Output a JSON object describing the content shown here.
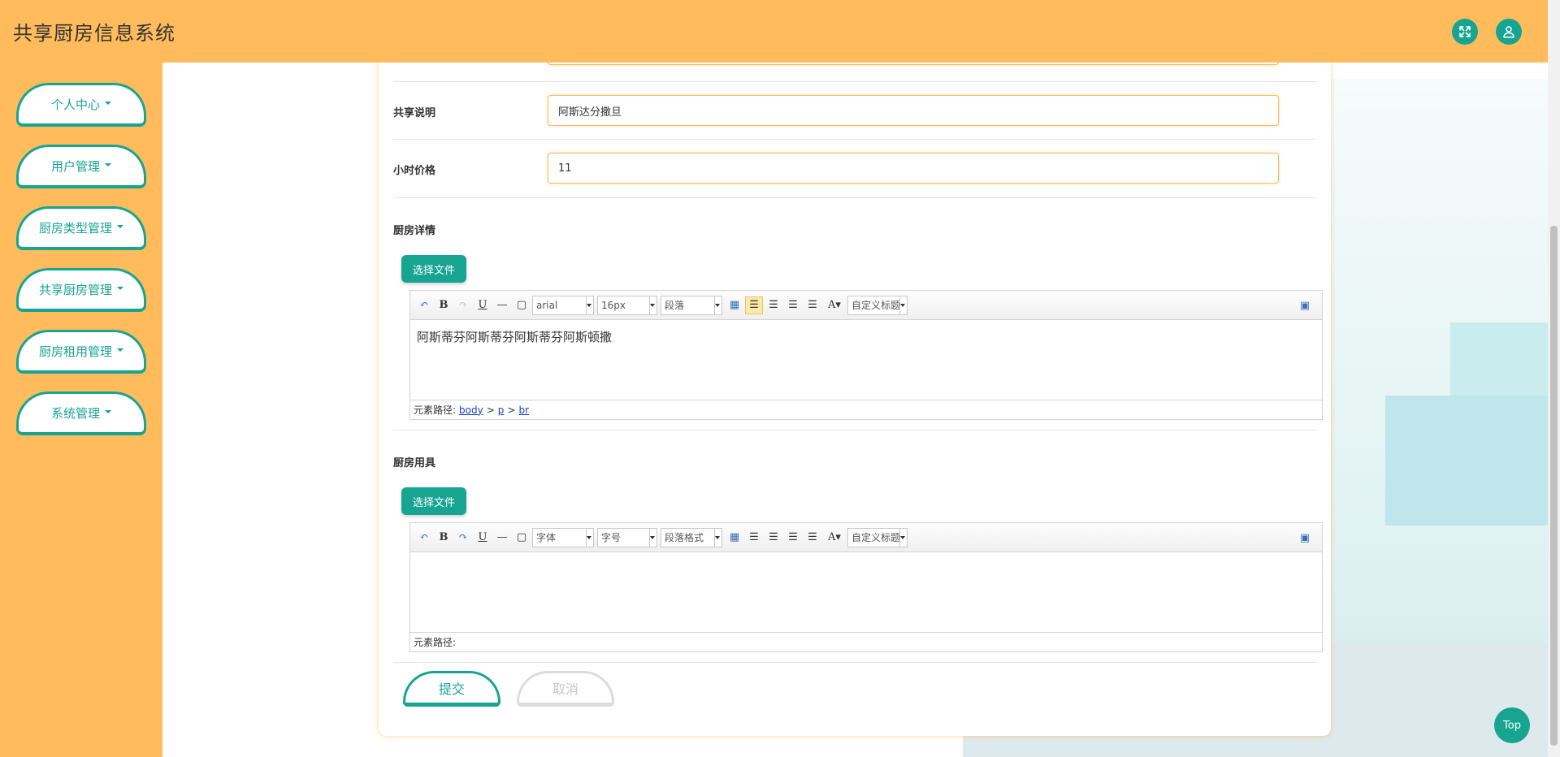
{
  "header": {
    "title": "共享厨房信息系统"
  },
  "sidebar": {
    "items": [
      {
        "label": "个人中心"
      },
      {
        "label": "用户管理"
      },
      {
        "label": "厨房类型管理"
      },
      {
        "label": "共享厨房管理"
      },
      {
        "label": "厨房租用管理"
      },
      {
        "label": "系统管理"
      }
    ]
  },
  "form": {
    "share_desc": {
      "label": "共享说明",
      "value": "阿斯达分撒旦"
    },
    "hour_price": {
      "label": "小时价格",
      "value": "11"
    },
    "kitchen_detail": {
      "label": "厨房详情",
      "file_button": "选择文件",
      "font": "arial",
      "size": "16px",
      "paragraph": "段落",
      "custom_title": "自定义标题",
      "content": "阿斯蒂芬阿斯蒂芬阿斯蒂芬阿斯顿撒",
      "path_label": "元素路径:",
      "path": [
        "body",
        "p",
        "br"
      ]
    },
    "kitchen_tools": {
      "label": "厨房用具",
      "file_button": "选择文件",
      "font": "字体",
      "size": "字号",
      "paragraph": "段落格式",
      "custom_title": "自定义标题",
      "path_label": "元素路径:"
    },
    "submit_label": "提交",
    "cancel_label": "取消"
  },
  "top_button": "Top",
  "colors": {
    "accent": "#17a592",
    "header": "#ffbb5c"
  }
}
